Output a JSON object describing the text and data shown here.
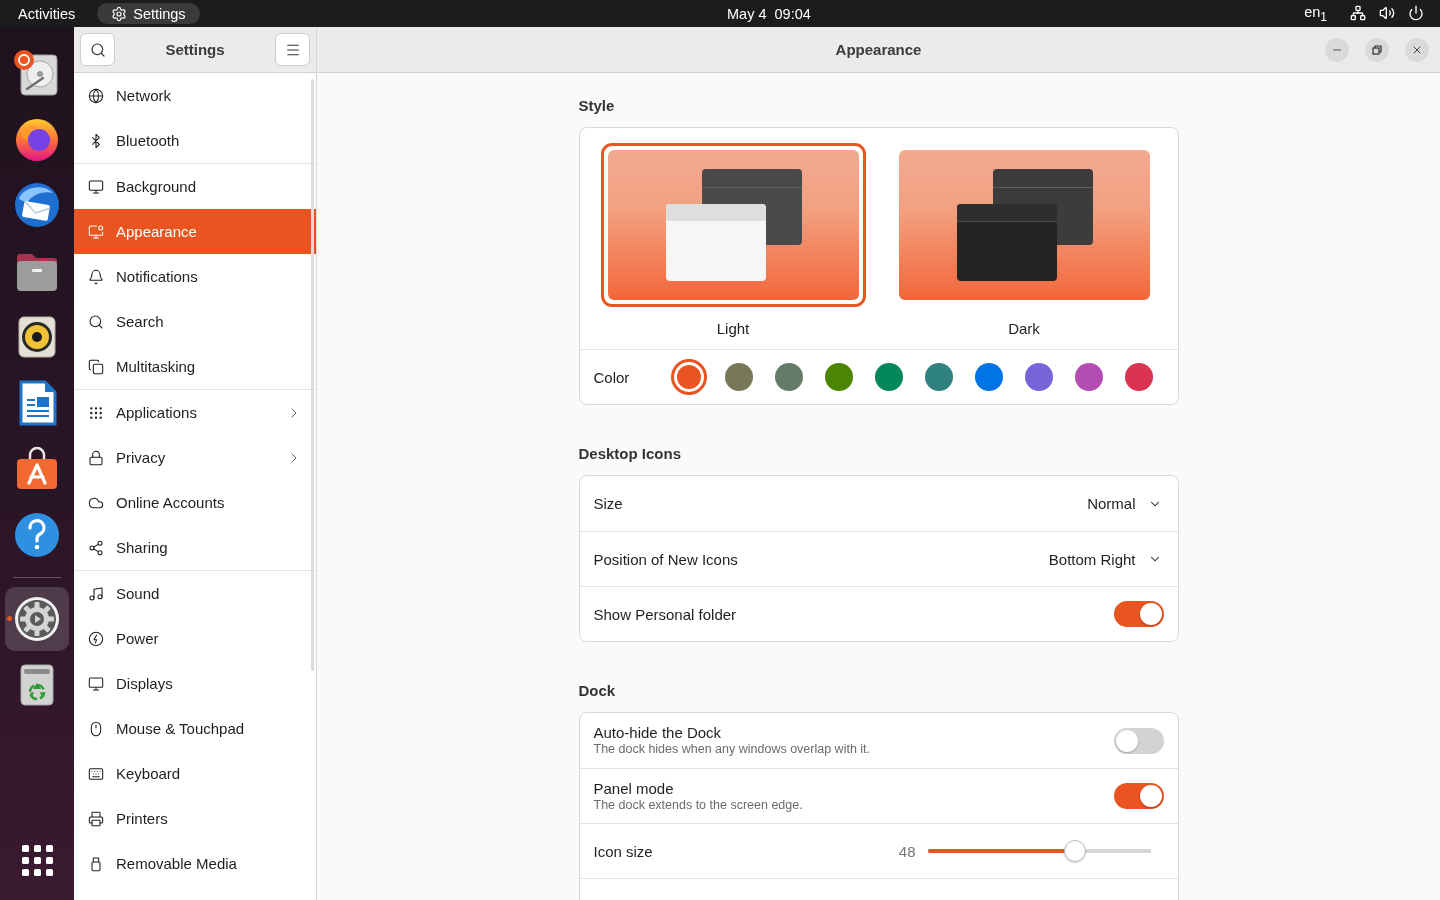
{
  "top_bar": {
    "activities": "Activities",
    "app_menu": "Settings",
    "clock": "May 4  09:04",
    "input_source": "en$_{1}$"
  },
  "dock": {
    "groups": [
      {
        "items": [
          {
            "kind": "disk",
            "selected": false,
            "running": false
          },
          {
            "kind": "browser",
            "selected": false,
            "running": false
          },
          {
            "kind": "mail",
            "selected": false,
            "running": false
          },
          {
            "kind": "folder",
            "selected": false,
            "running": false
          },
          {
            "kind": "speaker",
            "selected": false,
            "running": false
          },
          {
            "kind": "document",
            "selected": false,
            "running": false
          },
          {
            "kind": "store",
            "selected": false,
            "running": false
          },
          {
            "kind": "help",
            "selected": false,
            "running": false
          }
        ]
      },
      {
        "items": [
          {
            "kind": "settings",
            "selected": true,
            "running": true
          },
          {
            "kind": "trash",
            "selected": false,
            "running": false
          }
        ]
      }
    ]
  },
  "sidebar": {
    "title": "Settings",
    "groups": [
      {
        "items": [
          {
            "kind": "network",
            "label": "Network",
            "selected": false,
            "submenu": false
          },
          {
            "kind": "bluetooth",
            "label": "Bluetooth",
            "selected": false,
            "submenu": false
          }
        ]
      },
      {
        "items": [
          {
            "kind": "background",
            "label": "Background",
            "selected": false,
            "submenu": false
          },
          {
            "kind": "appearance",
            "label": "Appearance",
            "selected": true,
            "submenu": false
          },
          {
            "kind": "notifications",
            "label": "Notifications",
            "selected": false,
            "submenu": false
          },
          {
            "kind": "search",
            "label": "Search",
            "selected": false,
            "submenu": false
          },
          {
            "kind": "multitasking",
            "label": "Multitasking",
            "selected": false,
            "submenu": false
          }
        ]
      },
      {
        "items": [
          {
            "kind": "applications",
            "label": "Applications",
            "selected": false,
            "submenu": true
          },
          {
            "kind": "privacy",
            "label": "Privacy",
            "selected": false,
            "submenu": true
          },
          {
            "kind": "online_accounts",
            "label": "Online Accounts",
            "selected": false,
            "submenu": false
          },
          {
            "kind": "sharing",
            "label": "Sharing",
            "selected": false,
            "submenu": false
          }
        ]
      },
      {
        "items": [
          {
            "kind": "sound",
            "label": "Sound",
            "selected": false,
            "submenu": false
          },
          {
            "kind": "power",
            "label": "Power",
            "selected": false,
            "submenu": false
          },
          {
            "kind": "displays",
            "label": "Displays",
            "selected": false,
            "submenu": false
          },
          {
            "kind": "mouse",
            "label": "Mouse & Touchpad",
            "selected": false,
            "submenu": false
          },
          {
            "kind": "keyboard",
            "label": "Keyboard",
            "selected": false,
            "submenu": false
          },
          {
            "kind": "printers",
            "label": "Printers",
            "selected": false,
            "submenu": false
          },
          {
            "kind": "removable_media",
            "label": "Removable Media",
            "selected": false,
            "submenu": false
          }
        ]
      }
    ]
  },
  "page": {
    "title": "Appearance",
    "sections": [
      {
        "kind": "style",
        "heading": "Style",
        "themes": [
          {
            "kind": "light",
            "label": "Light",
            "selected": true
          },
          {
            "kind": "dark",
            "label": "Dark",
            "selected": false
          }
        ],
        "color_label": "Color",
        "accents": [
          {
            "color": "#e95420",
            "selected": true
          },
          {
            "color": "#787859",
            "selected": false
          },
          {
            "color": "#657b69",
            "selected": false
          },
          {
            "color": "#4b8501",
            "selected": false
          },
          {
            "color": "#03875b",
            "selected": false
          },
          {
            "color": "#308280",
            "selected": false
          },
          {
            "color": "#0073e5",
            "selected": false
          },
          {
            "color": "#7764d8",
            "selected": false
          },
          {
            "color": "#b34cb3",
            "selected": false
          },
          {
            "color": "#da3450",
            "selected": false
          }
        ]
      },
      {
        "kind": "list",
        "heading": "Desktop Icons",
        "continues": false,
        "rows": [
          {
            "kind": "dropdown",
            "label": "Size",
            "value": "Normal"
          },
          {
            "kind": "dropdown",
            "label": "Position of New Icons",
            "value": "Bottom Right"
          },
          {
            "kind": "switch",
            "label": "Show Personal folder",
            "on": true
          }
        ]
      },
      {
        "kind": "list",
        "heading": "Dock",
        "continues": true,
        "rows": [
          {
            "kind": "switch",
            "label": "Auto-hide the Dock",
            "subtitle": "The dock hides when any windows overlap with it.",
            "on": false
          },
          {
            "kind": "switch",
            "label": "Panel mode",
            "subtitle": "The dock extends to the screen edge.",
            "on": true
          },
          {
            "kind": "slider",
            "label": "Icon size",
            "value": "48",
            "level": 0.66
          }
        ]
      }
    ]
  }
}
